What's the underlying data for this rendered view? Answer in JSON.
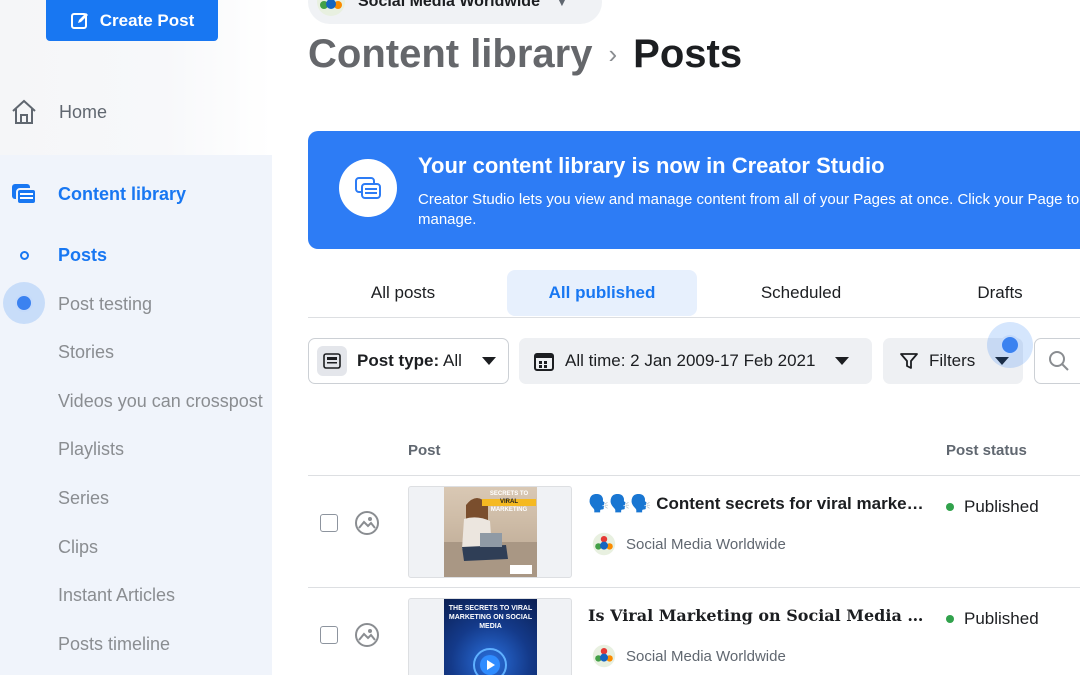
{
  "sidebar": {
    "create_post_label": "Create Post",
    "home_label": "Home",
    "content_library_label": "Content library",
    "items": [
      {
        "label": "Posts",
        "active": true
      },
      {
        "label": "Post testing"
      },
      {
        "label": "Stories"
      },
      {
        "label": "Videos you can crosspost"
      },
      {
        "label": "Playlists"
      },
      {
        "label": "Series"
      },
      {
        "label": "Clips"
      },
      {
        "label": "Instant Articles"
      },
      {
        "label": "Posts timeline"
      }
    ]
  },
  "header": {
    "page_name": "Social Media Worldwide",
    "breadcrumb_parent": "Content library",
    "breadcrumb_current": "Posts"
  },
  "banner": {
    "title": "Your content library is now in Creator Studio",
    "text": "Creator Studio lets you view and manage content from all of your Pages at once. Click your Page to manage."
  },
  "tabs": [
    {
      "label": "All posts"
    },
    {
      "label": "All published",
      "active": true
    },
    {
      "label": "Scheduled"
    },
    {
      "label": "Drafts"
    }
  ],
  "filters": {
    "post_type_prefix": "Post type:",
    "post_type_value": "All",
    "date_label": "All time: 2 Jan 2009-17 Feb 2021",
    "filters_label": "Filters"
  },
  "table": {
    "columns": {
      "post": "Post",
      "status": "Post status"
    },
    "rows": [
      {
        "title": "🗣️🗣️🗣️ Content secrets for viral marketing",
        "page": "Social Media Worldwide",
        "status": "Published",
        "thumb_line1": "SECRETS TO",
        "thumb_line2": "VIRAL",
        "thumb_line3": "MARKETING"
      },
      {
        "title": "Is Viral Marketing on Social Media Worth It?",
        "page": "Social Media Worldwide",
        "status": "Published",
        "thumb_text": "THE SECRETS TO VIRAL MARKETING ON SOCIAL MEDIA"
      }
    ]
  },
  "colors": {
    "accent": "#1877f2",
    "banner": "#2d7cf5",
    "published": "#31a24c"
  }
}
